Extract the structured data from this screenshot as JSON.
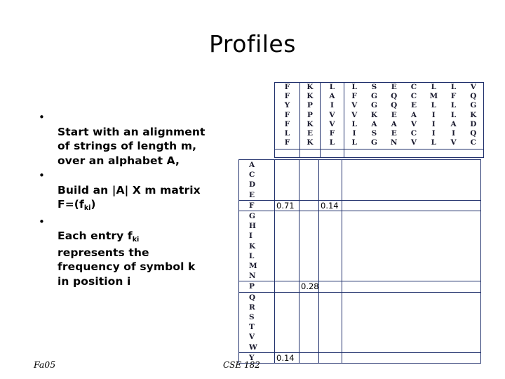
{
  "slide": {
    "title": "Profiles"
  },
  "bullets": {
    "marker": "•",
    "items": [
      {
        "text": "Start with an alignment\nof strings of length m,\nover an alphabet A,",
        "sub": null,
        "tail": null
      },
      {
        "text": "Build an |A| X m matrix\nF=(f",
        "sub": "ki",
        "tail": ")"
      },
      {
        "text": "Each entry f",
        "sub": "ki",
        "tail": "\nrepresents the\nfrequency of symbol k\nin position i"
      }
    ]
  },
  "alignment": {
    "rows": 7,
    "columns": [
      {
        "letters": [
          "F",
          "F",
          "Y",
          "F",
          "F",
          "L",
          "F"
        ]
      },
      {
        "letters": [
          "K",
          "K",
          "P",
          "P",
          "K",
          "E",
          "K"
        ]
      },
      {
        "letters": [
          "L",
          "A",
          "I",
          "V",
          "V",
          "F",
          "L"
        ]
      },
      {
        "letters": [
          "L",
          "F",
          "V",
          "V",
          "L",
          "I",
          "L"
        ]
      },
      {
        "letters": [
          "S",
          "G",
          "G",
          "K",
          "A",
          "S",
          "G"
        ]
      },
      {
        "letters": [
          "E",
          "Q",
          "Q",
          "E",
          "A",
          "E",
          "N"
        ]
      },
      {
        "letters": [
          "C",
          "C",
          "E",
          "A",
          "V",
          "C",
          "V"
        ]
      },
      {
        "letters": [
          "L",
          "M",
          "L",
          "I",
          "I",
          "I",
          "L"
        ]
      },
      {
        "letters": [
          "L",
          "F",
          "L",
          "L",
          "A",
          "I",
          "V"
        ]
      },
      {
        "letters": [
          "V",
          "Q",
          "G",
          "K",
          "D",
          "Q",
          "C"
        ]
      }
    ]
  },
  "matrix": {
    "groups": [
      {
        "labels": [
          "A",
          "C",
          "D",
          "E"
        ],
        "values": [
          "",
          "",
          "",
          ""
        ]
      },
      {
        "labels": [
          "F"
        ],
        "values": [
          "0.71",
          "",
          "0.14",
          ""
        ]
      },
      {
        "labels": [
          "G",
          "H",
          "I",
          "K",
          "L",
          "M",
          "N"
        ],
        "values": [
          "",
          "",
          "",
          ""
        ]
      },
      {
        "labels": [
          "P"
        ],
        "values": [
          "",
          "0.28",
          "",
          ""
        ]
      },
      {
        "labels": [
          "Q",
          "R",
          "S",
          "T",
          "V",
          "W"
        ],
        "values": [
          "",
          "",
          "",
          ""
        ]
      },
      {
        "labels": [
          "Y"
        ],
        "values": [
          "0.14",
          "",
          "",
          ""
        ]
      }
    ]
  },
  "footer": {
    "left": "Fa05",
    "center": "CSE 182"
  },
  "colors": {
    "grid_line": "#1f2f6b",
    "text": "#000000",
    "sequence_text": "#1a1a2e"
  }
}
